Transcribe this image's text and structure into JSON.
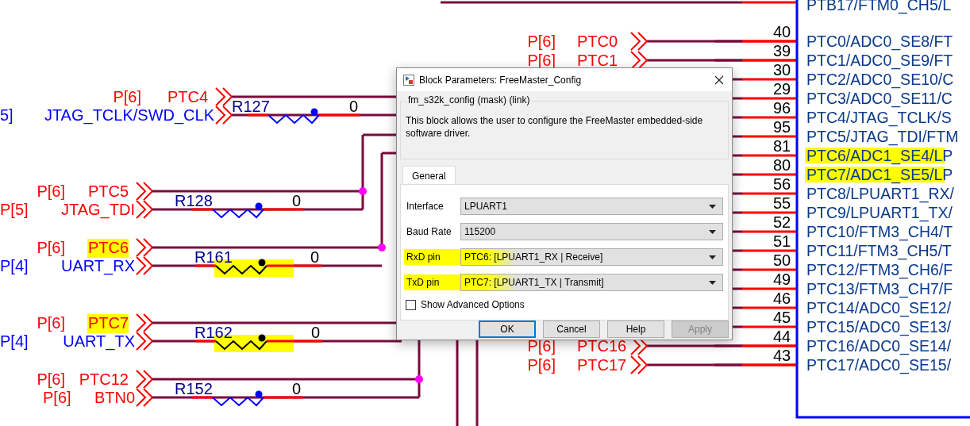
{
  "left_circuits": [
    {
      "top": {
        "sheet": "P[6]",
        "net": "PTC4",
        "color": "#ff0000",
        "highlighted": false
      },
      "bottom": {
        "sheet": "5]",
        "net": "JTAG_TCLK/SWD_CLK",
        "color": "#0000ff",
        "highlighted": false
      },
      "resistor": {
        "ref": "R127",
        "value": "0",
        "highlighted": false
      }
    },
    {
      "top": {
        "sheet": "P[6]",
        "net": "PTC5",
        "color": "#ff0000",
        "highlighted": false
      },
      "bottom": {
        "sheet": "P[5]",
        "net": "JTAG_TDI",
        "color": "#ff0000",
        "highlighted": false
      },
      "resistor": {
        "ref": "R128",
        "value": "0",
        "highlighted": false
      }
    },
    {
      "top": {
        "sheet": "P[6]",
        "net": "PTC6",
        "color": "#ff0000",
        "highlighted": true
      },
      "bottom": {
        "sheet": "P[4]",
        "net": "UART_RX",
        "color": "#0000ff",
        "highlighted": false
      },
      "resistor": {
        "ref": "R161",
        "value": "0",
        "highlighted": true
      }
    },
    {
      "top": {
        "sheet": "P[6]",
        "net": "PTC7",
        "color": "#ff0000",
        "highlighted": true
      },
      "bottom": {
        "sheet": "P[4]",
        "net": "UART_TX",
        "color": "#0000ff",
        "highlighted": false
      },
      "resistor": {
        "ref": "R162",
        "value": "0",
        "highlighted": true
      }
    },
    {
      "top": {
        "sheet": "P[6]",
        "net": "PTC12",
        "color": "#ff0000",
        "highlighted": false
      },
      "bottom": {
        "sheet": "P[6]",
        "net": "BTN0",
        "color": "#ff0000",
        "highlighted": false
      },
      "resistor": {
        "ref": "R152",
        "value": "0",
        "highlighted": false
      }
    }
  ],
  "right_connectors": [
    {
      "sheet": "P[6]",
      "net": "PTC0"
    },
    {
      "sheet": "P[6]",
      "net": "PTC1"
    },
    {
      "sheet": "P[6]",
      "net": "PTC16"
    },
    {
      "sheet": "P[6]",
      "net": "PTC17"
    }
  ],
  "top_pin": {
    "name": "PTB17/FTM0_CH5/L"
  },
  "pins": [
    {
      "number": "40",
      "name": "PTC0/ADC0_SE8/FT",
      "highlighted": false
    },
    {
      "number": "39",
      "name": "PTC1/ADC0_SE9/FT",
      "highlighted": false
    },
    {
      "number": "30",
      "name": "PTC2/ADC0_SE10/C",
      "highlighted": false
    },
    {
      "number": "29",
      "name": "PTC3/ADC0_SE11/C",
      "highlighted": false
    },
    {
      "number": "96",
      "name": "PTC4/JTAG_TCLK/S",
      "highlighted": false
    },
    {
      "number": "95",
      "name": "PTC5/JTAG_TDI/FTM",
      "highlighted": false
    },
    {
      "number": "81",
      "name": "PTC6/ADC1_SE4/LP",
      "highlighted": true
    },
    {
      "number": "80",
      "name": "PTC7/ADC1_SE5/LP",
      "highlighted": true
    },
    {
      "number": "56",
      "name": "PTC8/LPUART1_RX/",
      "highlighted": false
    },
    {
      "number": "55",
      "name": "PTC9/LPUART1_TX/",
      "highlighted": false
    },
    {
      "number": "52",
      "name": "PTC10/FTM3_CH4/T",
      "highlighted": false
    },
    {
      "number": "51",
      "name": "PTC11/FTM3_CH5/T",
      "highlighted": false
    },
    {
      "number": "50",
      "name": "PTC12/FTM3_CH6/F",
      "highlighted": false
    },
    {
      "number": "49",
      "name": "PTC13/FTM3_CH7/F",
      "highlighted": false
    },
    {
      "number": "46",
      "name": "PTC14/ADC0_SE12/",
      "highlighted": false
    },
    {
      "number": "45",
      "name": "PTC15/ADC0_SE13/",
      "highlighted": false
    },
    {
      "number": "44",
      "name": "PTC16/ADC0_SE14/",
      "highlighted": false
    },
    {
      "number": "43",
      "name": "PTC17/ADC0_SE15/",
      "highlighted": false
    }
  ],
  "dialog": {
    "title": "Block Parameters: FreeMaster_Config",
    "group_title": "fm_s32k_config (mask) (link)",
    "description": "This block allows the user to configure the FreeMaster embedded-side software driver.",
    "tabs": [
      {
        "label": "General",
        "selected": true
      }
    ],
    "fields": [
      {
        "label": "Interface",
        "value": "LPUART1",
        "highlighted": false
      },
      {
        "label": "Baud Rate",
        "value": "115200",
        "highlighted": false
      },
      {
        "label": "RxD pin",
        "value": "PTC6: [LPUART1_RX | Receive]",
        "highlighted": true
      },
      {
        "label": "TxD pin",
        "value": "PTC7: [LPUART1_TX | Transmit]",
        "highlighted": true
      }
    ],
    "checkbox": {
      "label": "Show Advanced Options",
      "checked": false
    },
    "buttons": [
      {
        "label": "OK",
        "default": true,
        "disabled": false
      },
      {
        "label": "Cancel",
        "default": false,
        "disabled": false
      },
      {
        "label": "Help",
        "default": false,
        "disabled": false
      },
      {
        "label": "Apply",
        "default": false,
        "disabled": true
      }
    ]
  }
}
